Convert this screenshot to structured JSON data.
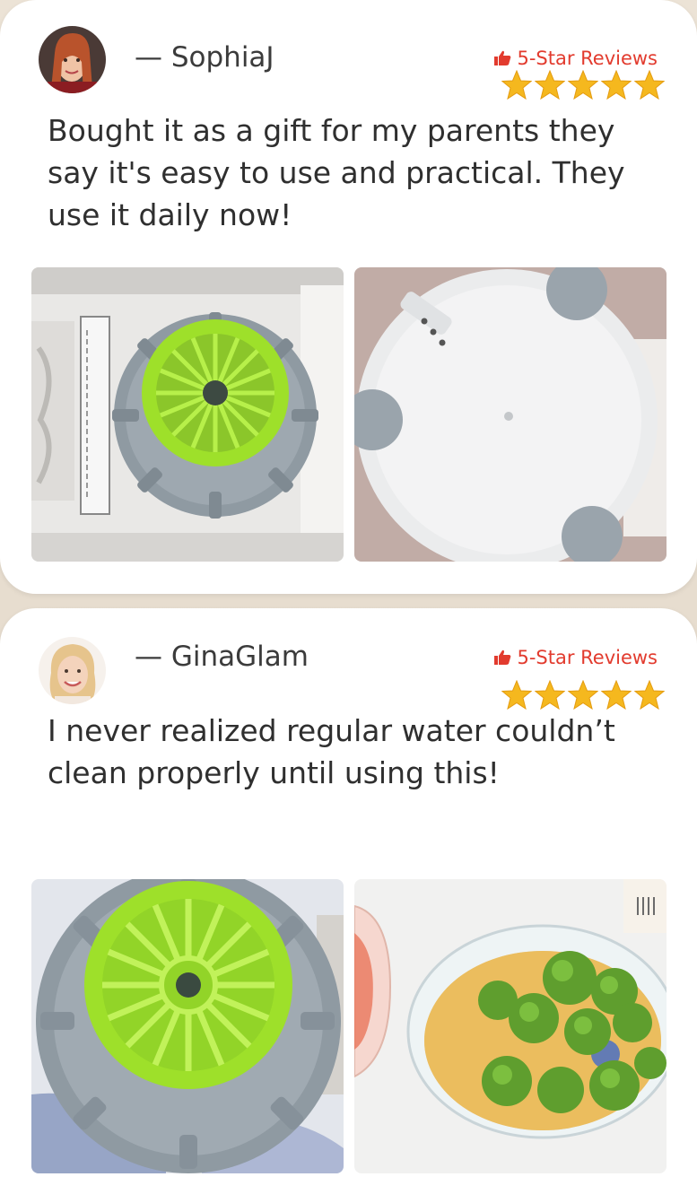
{
  "reviews": [
    {
      "author": "— SophiaJ",
      "badge": "5-Star Reviews",
      "rating": 5,
      "text": "Bought it as a gift for my parents they say it's easy to use and practical. They use it daily now!",
      "photos": [
        "product-in-box-photo",
        "product-underside-photo"
      ]
    },
    {
      "author": "— GinaGlam",
      "badge": "5-Star Reviews",
      "rating": 5,
      "text": "I never realized regular water couldn’t clean properly until using this!",
      "photos": [
        "product-top-photo",
        "broccoli-bowl-photo"
      ]
    }
  ],
  "colors": {
    "badge": "#e23b2e",
    "star": "#f5b81e",
    "product_green": "#9ee02a",
    "product_gray": "#8f9aa2"
  }
}
